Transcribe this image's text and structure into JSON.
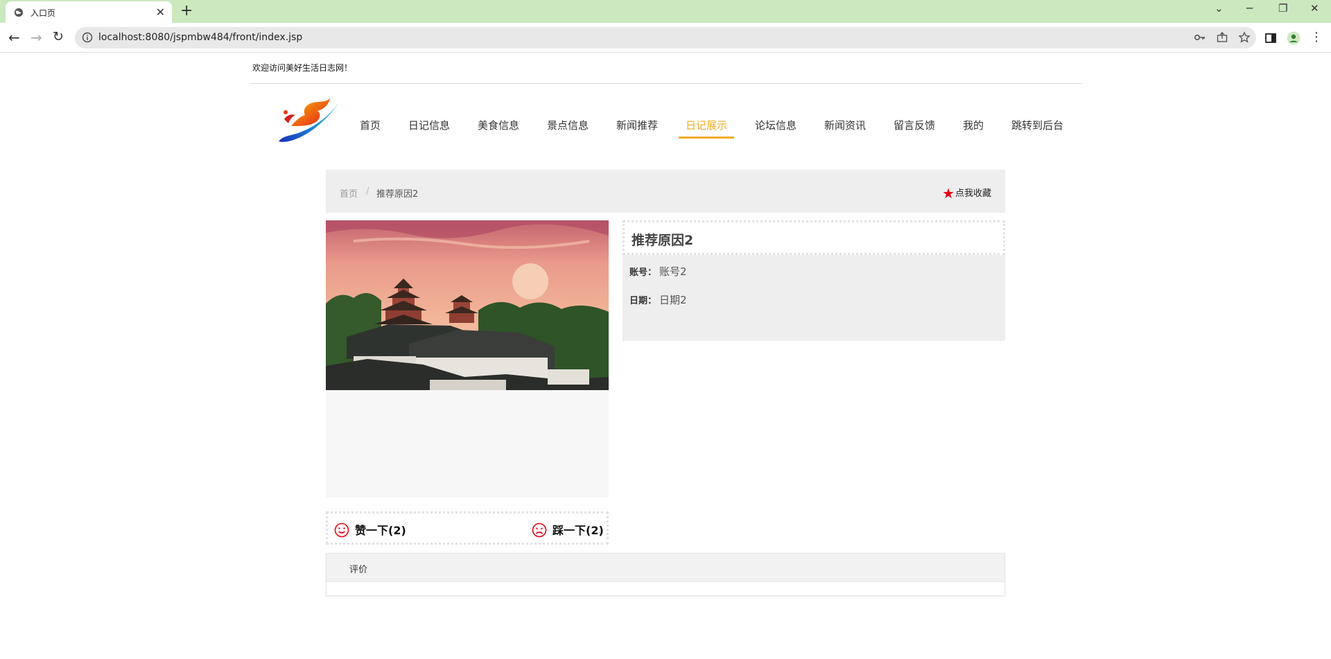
{
  "browser": {
    "tab_title": "入口页",
    "url": "localhost:8080/jspmbw484/front/index.jsp"
  },
  "page": {
    "welcome": "欢迎访问美好生活日志网！",
    "nav": [
      "首页",
      "日记信息",
      "美食信息",
      "景点信息",
      "新闻推荐",
      "日记展示",
      "论坛信息",
      "新闻资讯",
      "留言反馈",
      "我的",
      "跳转到后台"
    ],
    "nav_active": "日记展示",
    "breadcrumb": {
      "home": "首页",
      "separator": "/",
      "current": "推荐原因2"
    },
    "favorite_label": "点我收藏",
    "detail": {
      "title": "推荐原因2",
      "account_label": "账号：",
      "account_value": "账号2",
      "date_label": "日期：",
      "date_value": "日期2"
    },
    "votes": {
      "like": "赞一下(2)",
      "dislike": "踩一下(2)"
    },
    "comment_title": "评价"
  },
  "colors": {
    "accent": "#f0ad1e",
    "favorite_star": "#e60012",
    "vote_icon": "#e60012",
    "tabstrip": "#cbe8bf"
  }
}
